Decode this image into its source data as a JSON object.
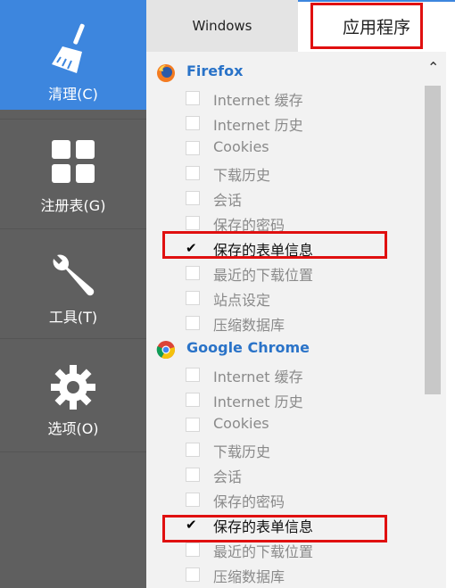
{
  "sidebar": {
    "items": [
      {
        "label": "清理(C)",
        "icon": "broom-icon"
      },
      {
        "label": "注册表(G)",
        "icon": "grid-icon"
      },
      {
        "label": "工具(T)",
        "icon": "wrench-icon"
      },
      {
        "label": "选项(O)",
        "icon": "gear-icon"
      }
    ]
  },
  "tabs": [
    {
      "label": "Windows"
    },
    {
      "label": "应用程序"
    }
  ],
  "groups": [
    {
      "name": "Firefox",
      "icon": "firefox-icon",
      "items": [
        {
          "label": "Internet 缓存",
          "checked": false
        },
        {
          "label": "Internet 历史",
          "checked": false
        },
        {
          "label": "Cookies",
          "checked": false
        },
        {
          "label": "下载历史",
          "checked": false
        },
        {
          "label": "会话",
          "checked": false
        },
        {
          "label": "保存的密码",
          "checked": false
        },
        {
          "label": "保存的表单信息",
          "checked": true
        },
        {
          "label": "最近的下载位置",
          "checked": false
        },
        {
          "label": "站点设定",
          "checked": false
        },
        {
          "label": "压缩数据库",
          "checked": false
        }
      ]
    },
    {
      "name": "Google Chrome",
      "icon": "chrome-icon",
      "items": [
        {
          "label": "Internet 缓存",
          "checked": false
        },
        {
          "label": "Internet 历史",
          "checked": false
        },
        {
          "label": "Cookies",
          "checked": false
        },
        {
          "label": "下载历史",
          "checked": false
        },
        {
          "label": "会话",
          "checked": false
        },
        {
          "label": "保存的密码",
          "checked": false
        },
        {
          "label": "保存的表单信息",
          "checked": true
        },
        {
          "label": "最近的下载位置",
          "checked": false
        },
        {
          "label": "压缩数据库",
          "checked": false
        }
      ]
    }
  ],
  "colors": {
    "sidebar_bg": "#5f5f5f",
    "active_item": "#3d86de",
    "group_title": "#2a73c8",
    "highlight": "#e01010"
  }
}
